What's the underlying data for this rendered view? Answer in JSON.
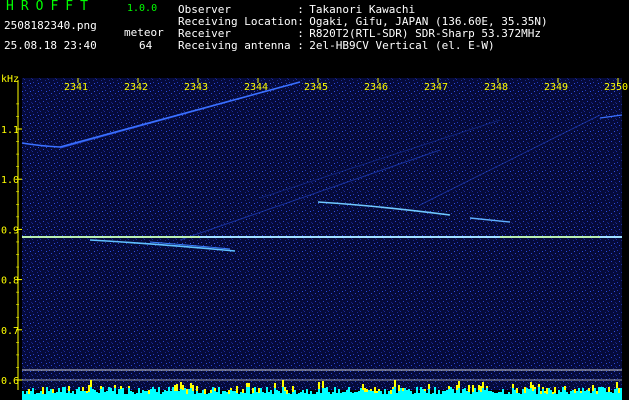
{
  "header": {
    "app_title": "HROFFT",
    "app_version": "1.0.0",
    "filename": "2508182340.png",
    "mode": "meteor",
    "datetime": "25.08.18 23:40",
    "count": "64"
  },
  "info": [
    {
      "label": "Observer",
      "value": "Takanori Kawachi"
    },
    {
      "label": "Receiving Location",
      "value": "Ogaki, Gifu, JAPAN (136.60E, 35.35N)"
    },
    {
      "label": "Receiver",
      "value": "R820T2(RTL-SDR) SDR-Sharp 53.372MHz"
    },
    {
      "label": "Receiving antenna",
      "value": "2el-HB9CV Vertical (el. E-W)"
    }
  ],
  "axis": {
    "y_unit": "kHz",
    "y_ticks": [
      "1.1",
      "1.0",
      "0.9",
      "0.8",
      "0.7",
      "0.6"
    ],
    "y_values": [
      1.1,
      1.0,
      0.9,
      0.8,
      0.7,
      0.6
    ],
    "x_ticks": [
      "2341",
      "2342",
      "2343",
      "2344",
      "2345",
      "2346",
      "2347",
      "2348",
      "2349",
      "2350"
    ]
  },
  "colors": {
    "background": "#000000",
    "noise": "#1a2a8c",
    "echo": "#60c0ff",
    "carrier": "#d0ff60",
    "axis_label": "#ffff00",
    "title": "#00ff00",
    "level_bars": "#00ffff",
    "level_peaks": "#ffff00"
  }
}
